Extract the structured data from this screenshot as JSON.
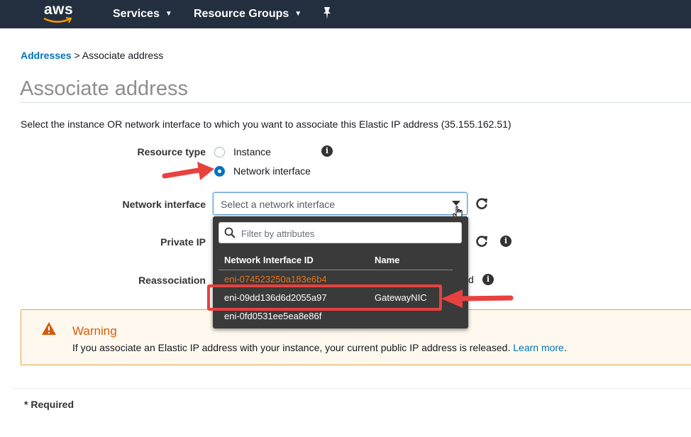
{
  "nav": {
    "logo": "aws",
    "services": "Services",
    "resource_groups": "Resource Groups"
  },
  "breadcrumb": {
    "parent": "Addresses",
    "separator": ">",
    "current": "Associate address"
  },
  "page_title": "Associate address",
  "description": "Select the instance OR network interface to which you want to associate this Elastic IP address (35.155.162.51)",
  "resource_type": {
    "label": "Resource type",
    "options": [
      "Instance",
      "Network interface"
    ],
    "selected": "Network interface"
  },
  "network_interface": {
    "label": "Network interface",
    "placeholder": "Select a network interface"
  },
  "dropdown": {
    "filter_placeholder": "Filter by attributes",
    "columns": [
      "Network Interface ID",
      "Name"
    ],
    "rows": [
      {
        "id": "eni-074523250a183e6b4",
        "name": ""
      },
      {
        "id": "eni-09dd136d6d2055a97",
        "name": "GatewayNIC"
      },
      {
        "id": "eni-0fd0531ee5ea8e86f",
        "name": ""
      }
    ]
  },
  "private_ip": {
    "label": "Private IP"
  },
  "reassociation": {
    "label": "Reassociation",
    "tail": "d"
  },
  "warning": {
    "title": "Warning",
    "text": "If you associate an Elastic IP address with your instance, your current public IP address is released.",
    "link": "Learn more",
    "end": "."
  },
  "required": "* Required",
  "colors": {
    "nav_bg": "#232f3e",
    "link": "#0073bb",
    "annotation_red": "#e8413f",
    "warning_orange": "#d45b07",
    "highlight_row_orange": "#ec7211"
  }
}
